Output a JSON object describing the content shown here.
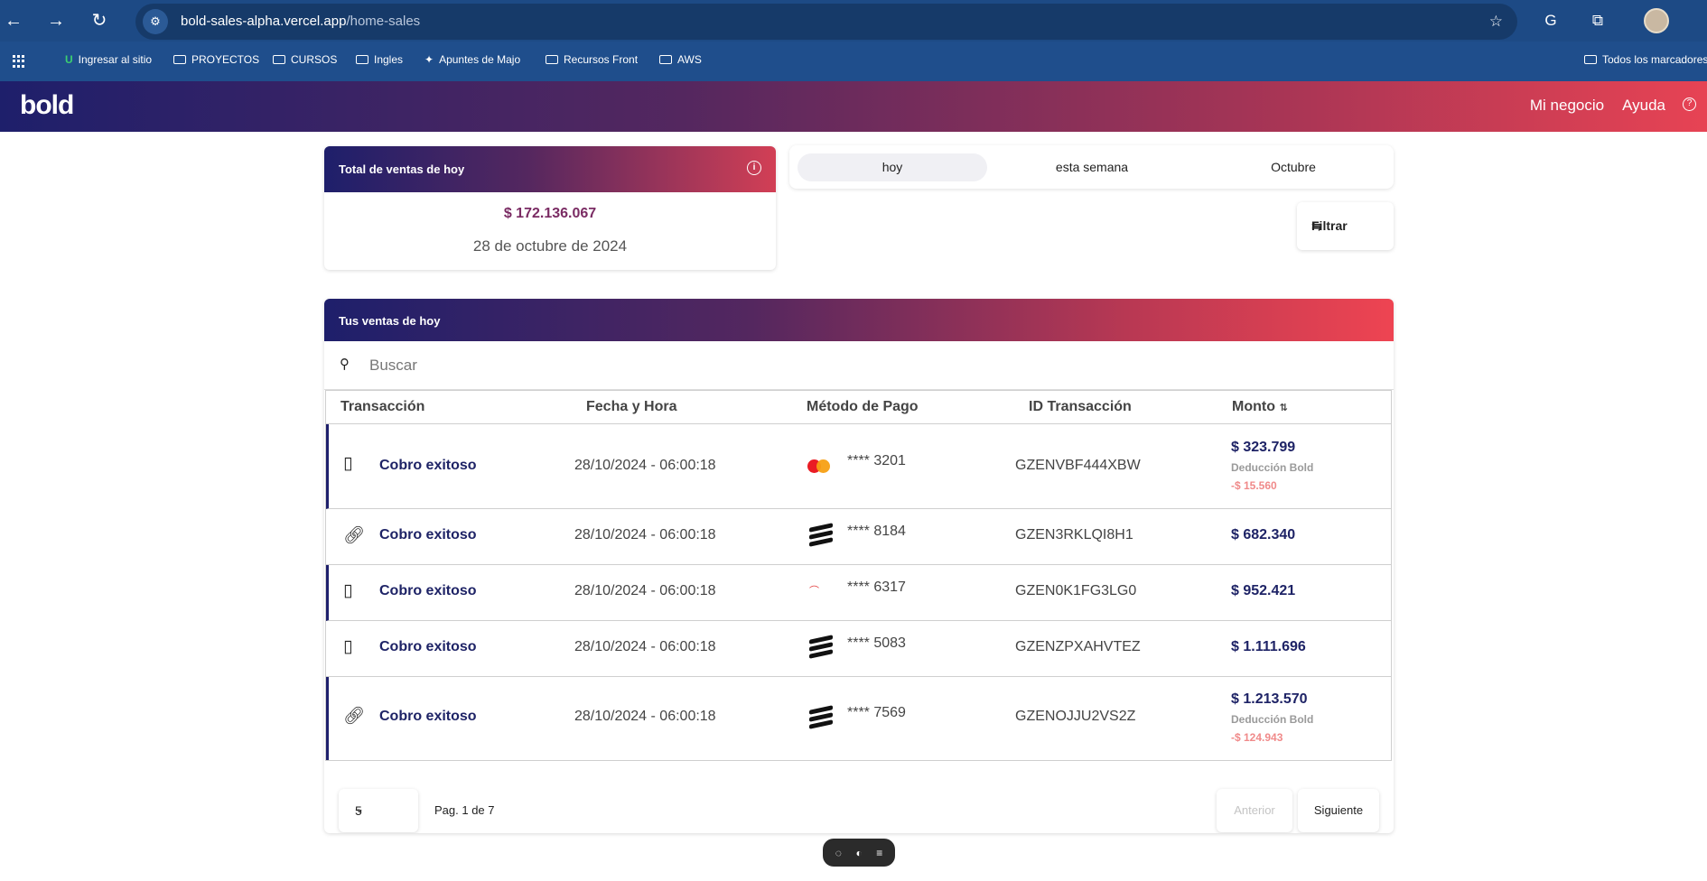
{
  "browser": {
    "url_host": "bold-sales-alpha.vercel.app",
    "url_path": "/home-sales",
    "bookmarks": [
      {
        "label": "Ingresar al sitio",
        "icon": "u-icon"
      },
      {
        "label": "PROYECTOS",
        "icon": "folder-icon"
      },
      {
        "label": "CURSOS",
        "icon": "folder-icon"
      },
      {
        "label": "Ingles",
        "icon": "folder-icon"
      },
      {
        "label": "Apuntes de Majo",
        "icon": "unicorn-icon"
      },
      {
        "label": "Recursos Front",
        "icon": "folder-icon"
      },
      {
        "label": "AWS",
        "icon": "folder-icon"
      }
    ],
    "all_bookmarks": "Todos los marcadores"
  },
  "header": {
    "logo": "bold",
    "nav": [
      "Mi negocio",
      "Ayuda"
    ]
  },
  "total_card": {
    "title": "Total de ventas de hoy",
    "amount": "$ 172.136.067",
    "date": "28 de octubre de 2024"
  },
  "period_tabs": [
    {
      "label": "hoy",
      "active": true
    },
    {
      "label": "esta semana",
      "active": false
    },
    {
      "label": "Octubre",
      "active": false
    }
  ],
  "filter": {
    "label": "Filtrar"
  },
  "sales": {
    "title": "Tus ventas de hoy",
    "search_placeholder": "Buscar",
    "columns": [
      "Transacción",
      "Fecha y Hora",
      "Método de Pago",
      "ID Transacción",
      "Monto"
    ],
    "rows": [
      {
        "type_icon": "pos-terminal-icon",
        "status": "Cobro exitoso",
        "datetime": "28/10/2024 - 06:00:18",
        "method_icon": "mastercard-icon",
        "card": "**** 3201",
        "id": "GZENVBF444XBW",
        "amount": "$ 323.799",
        "deduction_label": "Deducción Bold",
        "deduction": "-$ 15.560"
      },
      {
        "type_icon": "link-icon",
        "status": "Cobro exitoso",
        "datetime": "28/10/2024 - 06:00:18",
        "method_icon": "bancolombia-icon",
        "card": "**** 8184",
        "id": "GZEN3RKLQI8H1",
        "amount": "$ 682.340",
        "deduction_label": "",
        "deduction": ""
      },
      {
        "type_icon": "pos-terminal-icon",
        "status": "Cobro exitoso",
        "datetime": "28/10/2024 - 06:00:18",
        "method_icon": "daviplata-icon",
        "card": "**** 6317",
        "id": "GZEN0K1FG3LG0",
        "amount": "$ 952.421",
        "deduction_label": "",
        "deduction": ""
      },
      {
        "type_icon": "pos-terminal-icon",
        "status": "Cobro exitoso",
        "datetime": "28/10/2024 - 06:00:18",
        "method_icon": "bancolombia-icon",
        "card": "**** 5083",
        "id": "GZENZPXAHVTEZ",
        "amount": "$ 1.111.696",
        "deduction_label": "",
        "deduction": ""
      },
      {
        "type_icon": "link-icon",
        "status": "Cobro exitoso",
        "datetime": "28/10/2024 - 06:00:18",
        "method_icon": "bancolombia-icon",
        "card": "**** 7569",
        "id": "GZENOJJU2VS2Z",
        "amount": "$ 1.213.570",
        "deduction_label": "Deducción Bold",
        "deduction": "-$ 124.943"
      }
    ]
  },
  "pagination": {
    "page_size": "5",
    "info": "Pag. 1 de 7",
    "prev": "Anterior",
    "next": "Siguiente"
  },
  "colors": {
    "brand_dark": "#1e1f6b",
    "brand_red": "#ee4452",
    "amount_text": "#1e2366",
    "deduction_text": "#f08a8a"
  }
}
